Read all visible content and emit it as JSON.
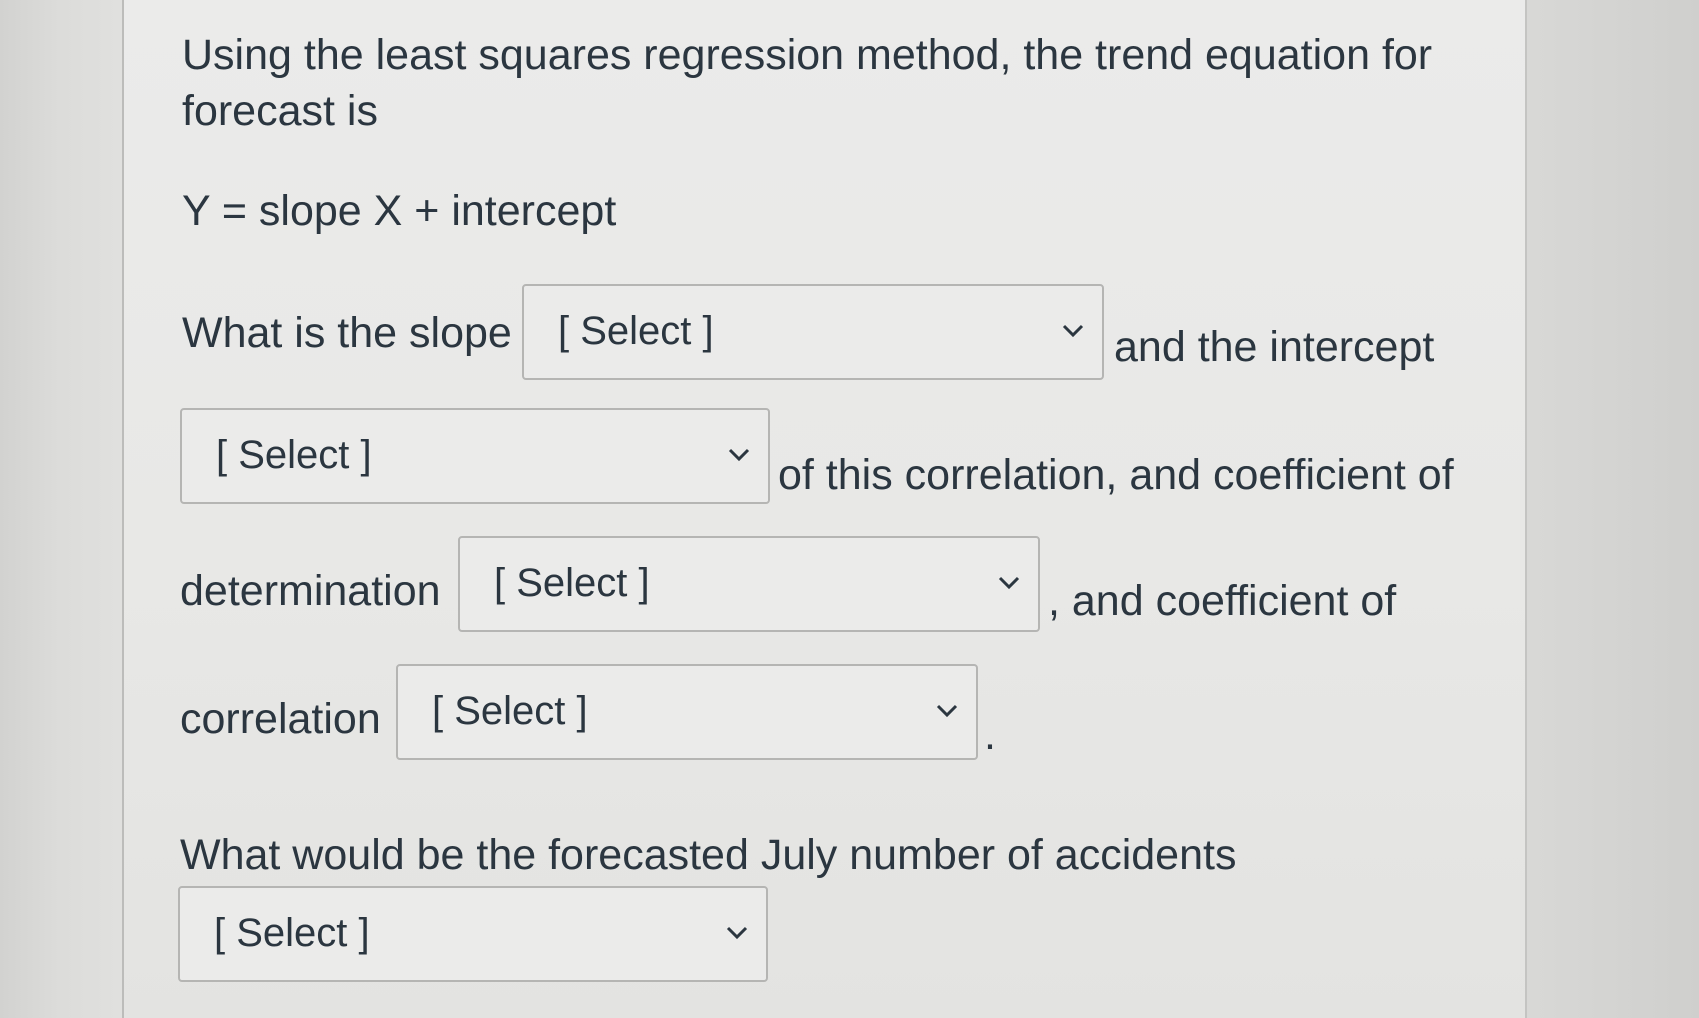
{
  "question": {
    "intro_line1": "Using the least squares regression method, the trend equation for",
    "intro_line2": "forecast is",
    "equation": "Y = slope X + intercept",
    "slope_prompt": "What is the slope",
    "intercept_prompt": "and the intercept",
    "correlation_prompt": "of this correlation, and coefficient of",
    "determination_label": "determination",
    "correlation_coef_suffix": ", and coefficient of",
    "correlation_label": "correlation",
    "period": ".",
    "forecast_prompt": "What would be the forecasted July number of accidents"
  },
  "dropdowns": {
    "slope": {
      "selected": "[ Select ]"
    },
    "intercept": {
      "selected": "[ Select ]"
    },
    "determination": {
      "selected": "[ Select ]"
    },
    "correlation": {
      "selected": "[ Select ]"
    },
    "forecast": {
      "selected": "[ Select ]"
    }
  },
  "icons": {
    "dropdown_arrow": "chevron-down-icon"
  }
}
